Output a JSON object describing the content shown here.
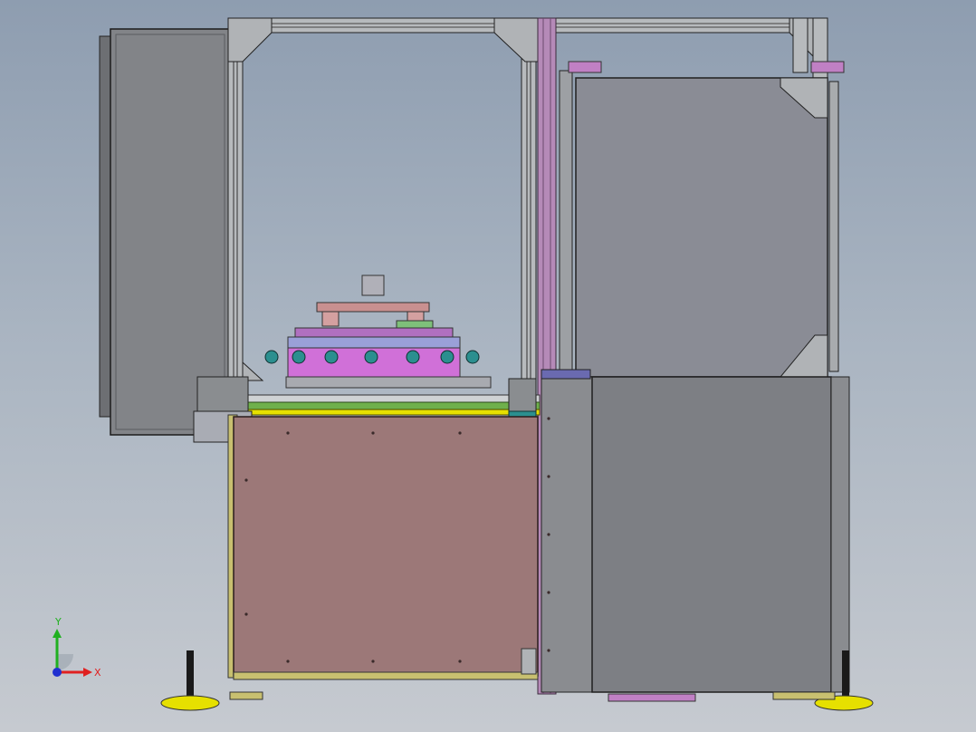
{
  "triad": {
    "x_label": "X",
    "y_label": "Y",
    "x_color": "#e02020",
    "y_color": "#20b020",
    "z_color": "#2030d0"
  },
  "colors": {
    "frame": "#c9ccd0",
    "frame_dark": "#4a4d52",
    "cabinet": "#9c7878",
    "panel_gray": "#7d7f84",
    "door_panel": "#8a8c95",
    "magenta": "#c060c8",
    "yellow": "#e6e000",
    "green": "#6fb04c"
  }
}
